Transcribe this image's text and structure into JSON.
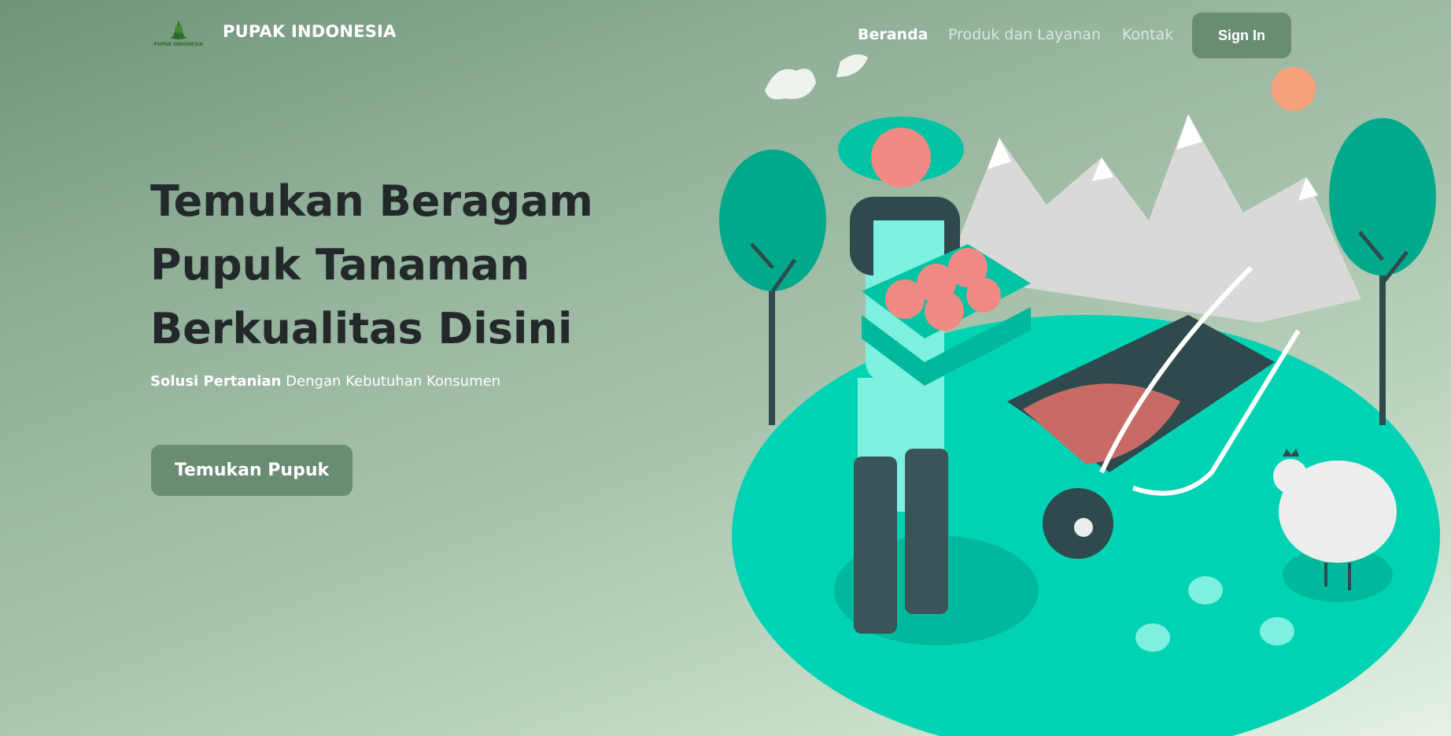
{
  "brand": {
    "name": "PUPAK INDONESIA",
    "logo_text": "PUPAK INDONESIA"
  },
  "nav": {
    "items": [
      {
        "label": "Beranda",
        "active": true
      },
      {
        "label": "Produk dan Layanan",
        "active": false
      },
      {
        "label": "Kontak",
        "active": false
      }
    ],
    "signin_label": "Sign In"
  },
  "hero": {
    "headline_lines": [
      "Temukan Beragam",
      "Pupuk Tanaman",
      "Berkualitas Disini"
    ],
    "sub_bold": "Solusi Pertanian",
    "sub_rest": " Dengan Kebutuhan Konsumen",
    "cta_label": "Temukan Pupuk"
  },
  "colors": {
    "accent": "#6a8c72",
    "teal": "#00d3b4",
    "headline": "#23292a"
  },
  "illustration": {
    "icon": "farmer-wheelbarrow-illustration"
  }
}
